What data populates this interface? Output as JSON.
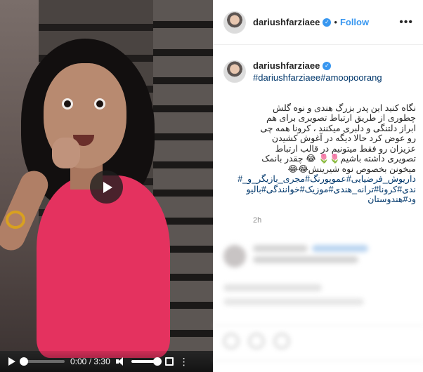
{
  "post": {
    "username": "dariushfarziaee",
    "verified_mark": "✓",
    "dot": "•",
    "follow_label": "Follow",
    "more_label": "•••"
  },
  "caption_block": {
    "username": "dariushfarziaee",
    "hashtags": "#dariushfarziaee#amoopoorang",
    "text": "نگاه کنید این پدر بزرگ هندی و نوه گلش چطوری از طریق ارتباط تصویری برای هم ابراز دلتنگی و دلبری میکنند ، کرونا همه چی رو عوض کرد حالا دیگه در آغوش کشیدن عزیزان رو فقط میتونیم در قالب ارتباط تصویری داشته باشیم🌷🌷 😂 چقدر بانمک میخونن بخصوص نوه شیرینش😂😂",
    "tags_text": "داریوش_فرضیایی#عموپورنگ#مجری_بازیگر_و_# ندی#کرونا#ترانه_هندی#موزیک#خوانندگی#بالیو ود#هندوستان",
    "time_ago": "2h"
  },
  "video": {
    "current_time": "0:00",
    "separator": "/",
    "duration": "3:30",
    "progress": 0,
    "volume": 1.0,
    "more_label": "⋮"
  }
}
